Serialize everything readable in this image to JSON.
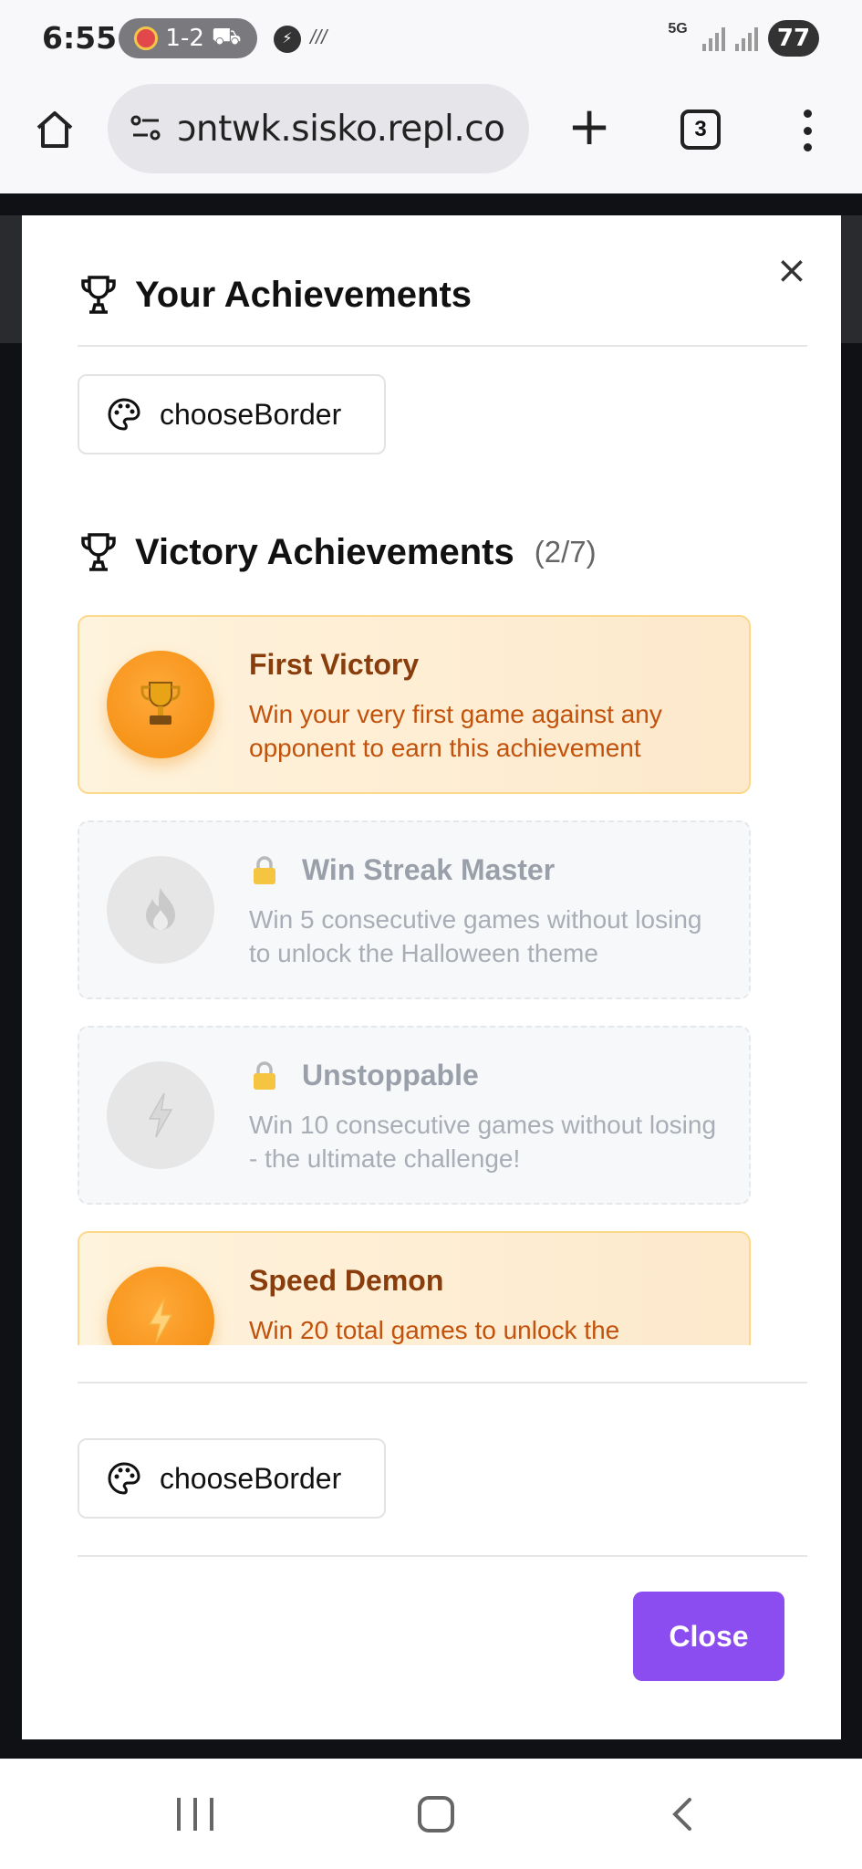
{
  "status_bar": {
    "time": "6:55",
    "pill_text": "1-2",
    "network_label": "5G",
    "battery": "77"
  },
  "browser": {
    "url": "ɔntwk.sisko.repl.co",
    "tab_count": "3"
  },
  "modal": {
    "your_title": "Your Achievements",
    "top_button_label": "chooseBorder",
    "victory_title": "Victory Achievements",
    "victory_count": "(2/7)",
    "achievements": [
      {
        "title": "First Victory",
        "description": "Win your very first game against any opponent to earn this achievement",
        "unlocked": true,
        "icon": "trophy-icon"
      },
      {
        "title": "Win Streak Master",
        "description": "Win 5 consecutive games without losing to unlock the Halloween theme",
        "unlocked": false,
        "icon": "fire-icon"
      },
      {
        "title": "Unstoppable",
        "description": "Win 10 consecutive games without losing - the ultimate challenge!",
        "unlocked": false,
        "icon": "lightning-icon"
      },
      {
        "title": "Speed Demon",
        "description": "Win 20 total games to unlock the",
        "unlocked": true,
        "icon": "lightning-icon"
      }
    ],
    "bottom_button_label": "chooseBorder",
    "close_label": "Close"
  },
  "colors": {
    "primary_button": "#8b4df0",
    "unlocked_text": "#8a3d0c",
    "unlocked_desc": "#c2520c",
    "locked_text": "#9aa0aa"
  }
}
